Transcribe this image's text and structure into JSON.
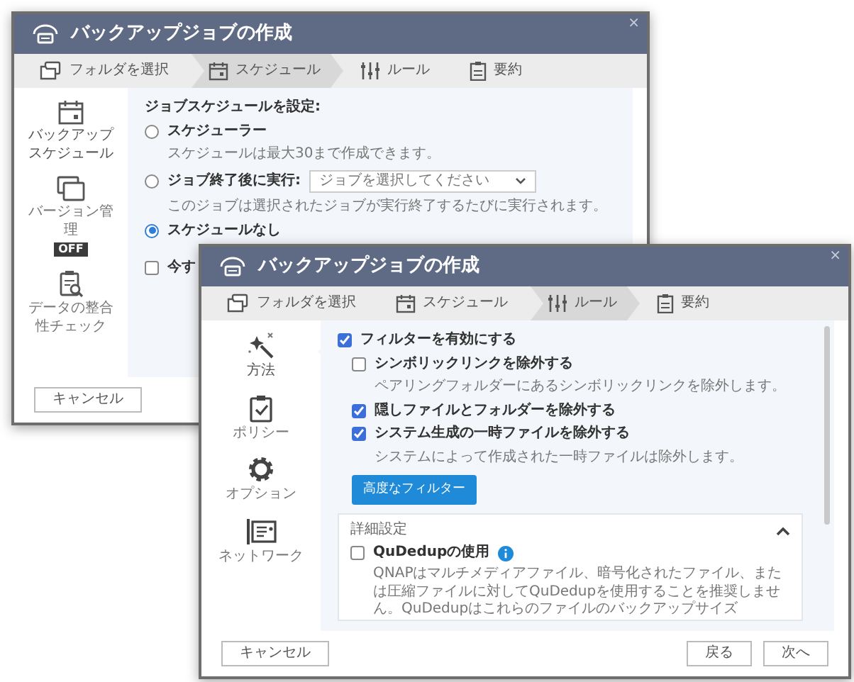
{
  "windows": [
    {
      "title": "バックアップジョブの作成",
      "close": "×",
      "steps": [
        {
          "label": "フォルダを選択",
          "selected": false
        },
        {
          "label": "スケジュール",
          "selected": true
        },
        {
          "label": "ルール",
          "selected": false
        },
        {
          "label": "要約",
          "selected": false
        }
      ],
      "sidebar": [
        {
          "label": "バックアップスケジュール",
          "selected": true
        },
        {
          "label": "バージョン管理",
          "badge": "OFF",
          "selected": false
        },
        {
          "label": "データの整合性チェック",
          "selected": false
        }
      ],
      "content": {
        "heading": "ジョブスケジュールを設定:",
        "items": [
          {
            "kind": "radio",
            "label": "スケジューラー",
            "description": "スケジュールは最大30まで作成できます。",
            "selected": false
          },
          {
            "kind": "radio",
            "label": "ジョブ終了後に実行:",
            "select": {
              "placeholder": "ジョブを選択してください"
            },
            "description": "このジョブは選択されたジョブが実行終了するたびに実行されます。",
            "selected": false
          },
          {
            "kind": "radio",
            "label": "スケジュールなし",
            "selected": true
          },
          {
            "kind": "checkbox",
            "label": "今す",
            "checked": false
          }
        ]
      },
      "buttons_left": [
        "キャンセル"
      ]
    },
    {
      "title": "バックアップジョブの作成",
      "close": "×",
      "steps": [
        {
          "label": "フォルダを選択",
          "selected": false
        },
        {
          "label": "スケジュール",
          "selected": false
        },
        {
          "label": "ルール",
          "selected": true
        },
        {
          "label": "要約",
          "selected": false
        }
      ],
      "sidebar": [
        {
          "label": "方法",
          "selected": true
        },
        {
          "label": "ポリシー",
          "selected": false
        },
        {
          "label": "オプション",
          "selected": false
        },
        {
          "label": "ネットワーク",
          "selected": false
        }
      ],
      "content": {
        "items": [
          {
            "kind": "checkbox",
            "label": "フィルターを有効にする",
            "checked": true,
            "children": [
              {
                "kind": "checkbox",
                "label": "シンボリックリンクを除外する",
                "description": "ペアリングフォルダーにあるシンボリックリンクを除外します。",
                "checked": false
              },
              {
                "kind": "checkbox",
                "label": "隠しファイルとフォルダーを除外する",
                "checked": true
              },
              {
                "kind": "checkbox",
                "label": "システム生成の一時ファイルを除外する",
                "description": "システムによって作成された一時ファイルは除外します。",
                "checked": true
              },
              {
                "kind": "button",
                "label": "高度なフィルター"
              }
            ]
          }
        ],
        "details": {
          "title": "詳細設定",
          "expanded": true,
          "items": [
            {
              "kind": "checkbox",
              "label": "QuDedupの使用",
              "info": true,
              "checked": false,
              "description": "QNAPはマルチメディアファイル、暗号化されたファイル、または圧縮ファイルに対してQuDedupを使用することを推奨しません。QuDedupはこれらのファイルのバックアップサイズ"
            }
          ]
        }
      },
      "buttons_left": [
        "キャンセル"
      ],
      "buttons_right": [
        "戻る",
        "次へ"
      ]
    }
  ]
}
